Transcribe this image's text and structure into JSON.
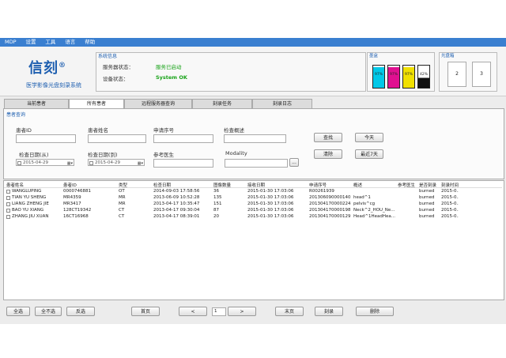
{
  "menu": [
    "MDP",
    "设置",
    "工具",
    "语言",
    "帮助"
  ],
  "logo": {
    "name": "信刻",
    "mark": "®",
    "subtitle": "医学影像光盘刻录系统"
  },
  "system": {
    "title": "系统信息",
    "server_label": "服务器状态：",
    "server_value": "服务已启动",
    "device_label": "设备状态：",
    "device_value": "System OK"
  },
  "toner": {
    "title": "墨盒",
    "levels": [
      {
        "color": "#00c8e8",
        "label": "97%"
      },
      {
        "color": "#e01090",
        "label": "97%"
      },
      {
        "color": "#f0e000",
        "label": "97%"
      },
      {
        "color": "#111111",
        "label": "42%"
      }
    ]
  },
  "drive": {
    "title": "光盘箱",
    "slots": [
      "2",
      "3"
    ]
  },
  "tabs": [
    "当前患者",
    "所有患者",
    "远程服务器查询",
    "刻录任务",
    "刻录日志"
  ],
  "query": {
    "title": "患者查询",
    "patient_id": "患者ID",
    "patient_name": "患者姓名",
    "request_no": "申请序号",
    "exam_desc": "检查概述",
    "date_from_label": "检查日期(从)",
    "date_from": "2015-04-29",
    "date_to_label": "检查日期(到)",
    "date_to": "2015-04-29",
    "referring": "参考医生",
    "modality": "Modality",
    "buttons": {
      "search": "查找",
      "today": "今天",
      "clear": "清除",
      "last7": "最近7天",
      "browse": "..."
    }
  },
  "table": {
    "headers": [
      "患者姓名",
      "患者ID",
      "类型",
      "检查日期",
      "图像数量",
      "接收日期",
      "申请序号",
      "概述",
      "参考医生",
      "是否刻录",
      "刻录时间"
    ],
    "rows": [
      [
        "WANGLUPING",
        "0000746881",
        "OT",
        "2014-09-03 17:58:56",
        "36",
        "2015-01-30 17:03:06",
        "R00261939",
        "",
        "",
        "burned",
        "2015-0..."
      ],
      [
        "TIAN YU SHENG",
        "MR4359",
        "MR",
        "2013-06-09 10:52:28",
        "135",
        "2015-01-30 17:03:06",
        "201306090000140",
        "head^1",
        "",
        "burned",
        "2015-0..."
      ],
      [
        "LIANG ZHENG JIE",
        "MR3417",
        "MR",
        "2013-04-17 10:35:47",
        "151",
        "2015-01-30 17:03:06",
        "201304170000224",
        "pelvis^cg",
        "",
        "burned",
        "2015-0..."
      ],
      [
        "BAO YU XIANG",
        "128CT19342",
        "CT",
        "2013-04-17 09:30:04",
        "87",
        "2015-01-30 17:03:06",
        "201304170000198",
        "Neck^2_HOU_Ne...",
        "",
        "burned",
        "2015-0..."
      ],
      [
        "ZHANG JIU XUAN",
        "16CT16968",
        "CT",
        "2013-04-17 08:39:01",
        "20",
        "2015-01-30 17:03:06",
        "201304170000129",
        "Head^1HeadHea...",
        "",
        "burned",
        "2015-0..."
      ]
    ]
  },
  "footer": {
    "select_all": "全选",
    "select_none": "全不选",
    "invert": "反选",
    "first": "首页",
    "prev": "<",
    "page": "1",
    "next": ">",
    "last": "末页",
    "burn": "刻录",
    "delete": "删除"
  }
}
